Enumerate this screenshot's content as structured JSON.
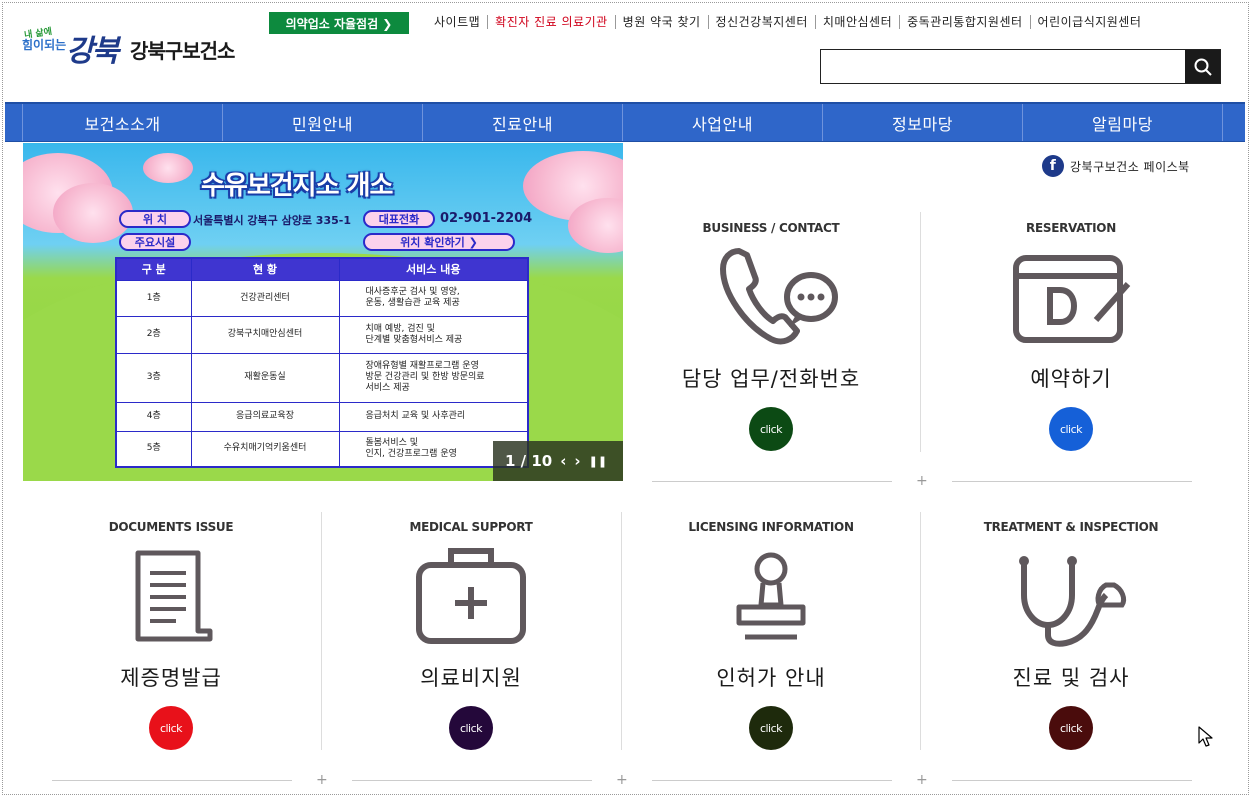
{
  "logo": {
    "slogan_small": "내 삶에",
    "slogan_mid": "힘이되는",
    "slogan_big": "강북",
    "name": "강북구보건소"
  },
  "header": {
    "selfcheck_label": "의약업소 자율점검 ❯",
    "top_links": [
      "사이트맵",
      "확진자 진료 의료기관",
      "병원 약국 찾기",
      "정신건강복지센터",
      "치매안심센터",
      "중독관리통합지원센터",
      "어린이급식지원센터"
    ],
    "search_value": ""
  },
  "nav": {
    "items": [
      "보건소소개",
      "민원안내",
      "진료안내",
      "사업안내",
      "정보마당",
      "알림마당"
    ]
  },
  "banner": {
    "title": "수유보건지소 개소",
    "location_label": "위 치",
    "address": "서울특별시 강북구 삼양로 335-1",
    "phone_label": "대표전화",
    "phone": "02-901-2204",
    "facilities_label": "주요시설",
    "map_button": "위치 확인하기 ❯",
    "table_headers": [
      "구 분",
      "현 황",
      "서비스 내용"
    ],
    "rows": [
      {
        "floor": "1층",
        "facility": "건강관리센터",
        "service": "대사증후군 검사 및 영양,\n운동, 생활습관 교육 제공"
      },
      {
        "floor": "2층",
        "facility": "강북구치매안심센터",
        "service": "치매 예방, 검진 및\n단계별 맞춤형서비스 제공"
      },
      {
        "floor": "3층",
        "facility": "재활운동실",
        "service": "장애유형별 재활프로그램 운영\n방문 건강관리 및 한방 방문의료\n서비스 제공"
      },
      {
        "floor": "4층",
        "facility": "응급의료교육장",
        "service": "응급처치 교육 및 사후관리"
      },
      {
        "floor": "5층",
        "facility": "수유치매기억키움센터",
        "service": "돌봄서비스 및\n인지, 건강프로그램 운영"
      }
    ],
    "slide_counter": "1 / 10",
    "prev_icon": "‹",
    "next_icon": "›",
    "pause_icon": "❚❚"
  },
  "facebook": {
    "label": "강북구보건소 페이스북",
    "icon_letter": "f"
  },
  "services": [
    {
      "en": "BUSINESS / CONTACT",
      "ko": "담당 업무/전화번호",
      "click": "click",
      "color": "#0c4a14",
      "icon": "phone-chat-icon"
    },
    {
      "en": "RESERVATION",
      "ko": "예약하기",
      "click": "click",
      "color": "#1560d8",
      "icon": "calendar-reserve-icon"
    },
    {
      "en": "DOCUMENTS ISSUE",
      "ko": "제증명발급",
      "click": "click",
      "color": "#e8111a",
      "icon": "document-icon"
    },
    {
      "en": "MEDICAL SUPPORT",
      "ko": "의료비지원",
      "click": "click",
      "color": "#24083a",
      "icon": "medical-kit-icon"
    },
    {
      "en": "LICENSING INFORMATION",
      "ko": "인허가 안내",
      "click": "click",
      "color": "#1e2a0c",
      "icon": "stamp-icon"
    },
    {
      "en": "TREATMENT & INSPECTION",
      "ko": "진료 및 검사",
      "click": "click",
      "color": "#4a0c0c",
      "icon": "stethoscope-icon"
    }
  ],
  "colors": {
    "nav": "#2f66c9",
    "selfcheck": "#0d8a3e",
    "icon_gray": "#5f585c"
  }
}
